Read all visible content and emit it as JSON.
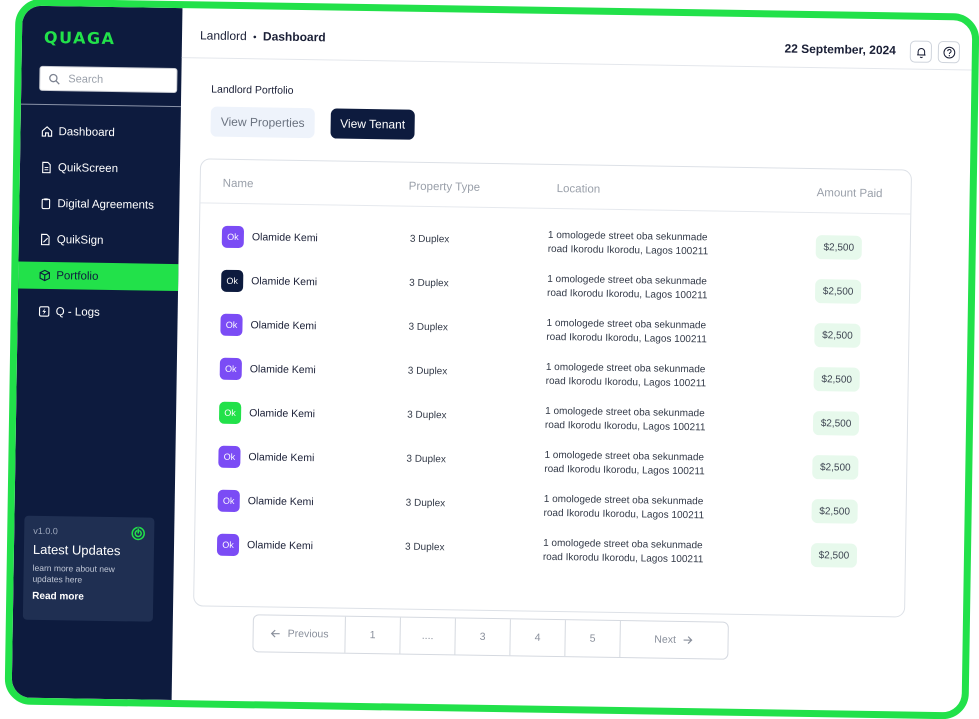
{
  "app": {
    "logo": "QUAGA"
  },
  "search": {
    "placeholder": "Search"
  },
  "nav": {
    "items": [
      {
        "label": "Dashboard",
        "icon": "home-icon"
      },
      {
        "label": "QuikScreen",
        "icon": "document-icon"
      },
      {
        "label": "Digital Agreements",
        "icon": "clipboard-icon"
      },
      {
        "label": "QuikSign",
        "icon": "signature-icon"
      },
      {
        "label": "Portfolio",
        "icon": "box-icon",
        "active": true
      },
      {
        "label": "Q - Logs",
        "icon": "lightning-icon"
      }
    ]
  },
  "updates": {
    "version": "v1.0.0",
    "title": "Latest Updates",
    "description": "learn more about new updates here",
    "link": "Read more"
  },
  "header": {
    "breadcrumb_parent": "Landlord",
    "breadcrumb_separator": "•",
    "breadcrumb_current": "Dashboard",
    "date": "22 September, 2024"
  },
  "portfolio": {
    "label": "Landlord Portfolio",
    "view_properties": "View Properties",
    "view_tenant": "View Tenant"
  },
  "table": {
    "columns": [
      "Name",
      "Property Type",
      "Location",
      "Amount Paid"
    ],
    "rows": [
      {
        "initials": "Ok",
        "avatar_color": "#7b4cf5",
        "name": "Olamide Kemi",
        "type": "3 Duplex",
        "location_1": "1 omologede street oba sekunmade",
        "location_2": "road Ikorodu Ikorodu, Lagos 100211",
        "amount": "$2,500"
      },
      {
        "initials": "Ok",
        "avatar_color": "#0d1b3e",
        "name": "Olamide Kemi",
        "type": "3 Duplex",
        "location_1": "1 omologede street oba sekunmade",
        "location_2": "road Ikorodu Ikorodu, Lagos 100211",
        "amount": "$2,500"
      },
      {
        "initials": "Ok",
        "avatar_color": "#7b4cf5",
        "name": "Olamide Kemi",
        "type": "3 Duplex",
        "location_1": "1 omologede street oba sekunmade",
        "location_2": "road Ikorodu Ikorodu, Lagos 100211",
        "amount": "$2,500"
      },
      {
        "initials": "Ok",
        "avatar_color": "#7b4cf5",
        "name": "Olamide Kemi",
        "type": "3 Duplex",
        "location_1": "1 omologede street oba sekunmade",
        "location_2": "road Ikorodu Ikorodu, Lagos 100211",
        "amount": "$2,500"
      },
      {
        "initials": "Ok",
        "avatar_color": "#22e14a",
        "name": "Olamide Kemi",
        "type": "3 Duplex",
        "location_1": "1 omologede street oba sekunmade",
        "location_2": "road Ikorodu Ikorodu, Lagos 100211",
        "amount": "$2,500"
      },
      {
        "initials": "Ok",
        "avatar_color": "#7b4cf5",
        "name": "Olamide Kemi",
        "type": "3 Duplex",
        "location_1": "1 omologede street oba sekunmade",
        "location_2": "road Ikorodu Ikorodu, Lagos 100211",
        "amount": "$2,500"
      },
      {
        "initials": "Ok",
        "avatar_color": "#7b4cf5",
        "name": "Olamide Kemi",
        "type": "3 Duplex",
        "location_1": "1 omologede street oba sekunmade",
        "location_2": "road Ikorodu Ikorodu, Lagos 100211",
        "amount": "$2,500"
      },
      {
        "initials": "Ok",
        "avatar_color": "#7b4cf5",
        "name": "Olamide Kemi",
        "type": "3 Duplex",
        "location_1": "1 omologede street oba sekunmade",
        "location_2": "road Ikorodu Ikorodu, Lagos 100211",
        "amount": "$2,500"
      }
    ]
  },
  "pagination": {
    "previous": "Previous",
    "pages": [
      "1",
      "....",
      "3",
      "4",
      "5"
    ],
    "next": "Next"
  },
  "colors": {
    "accent": "#22e14a",
    "navy": "#0d1b3e",
    "purple": "#7b4cf5"
  }
}
